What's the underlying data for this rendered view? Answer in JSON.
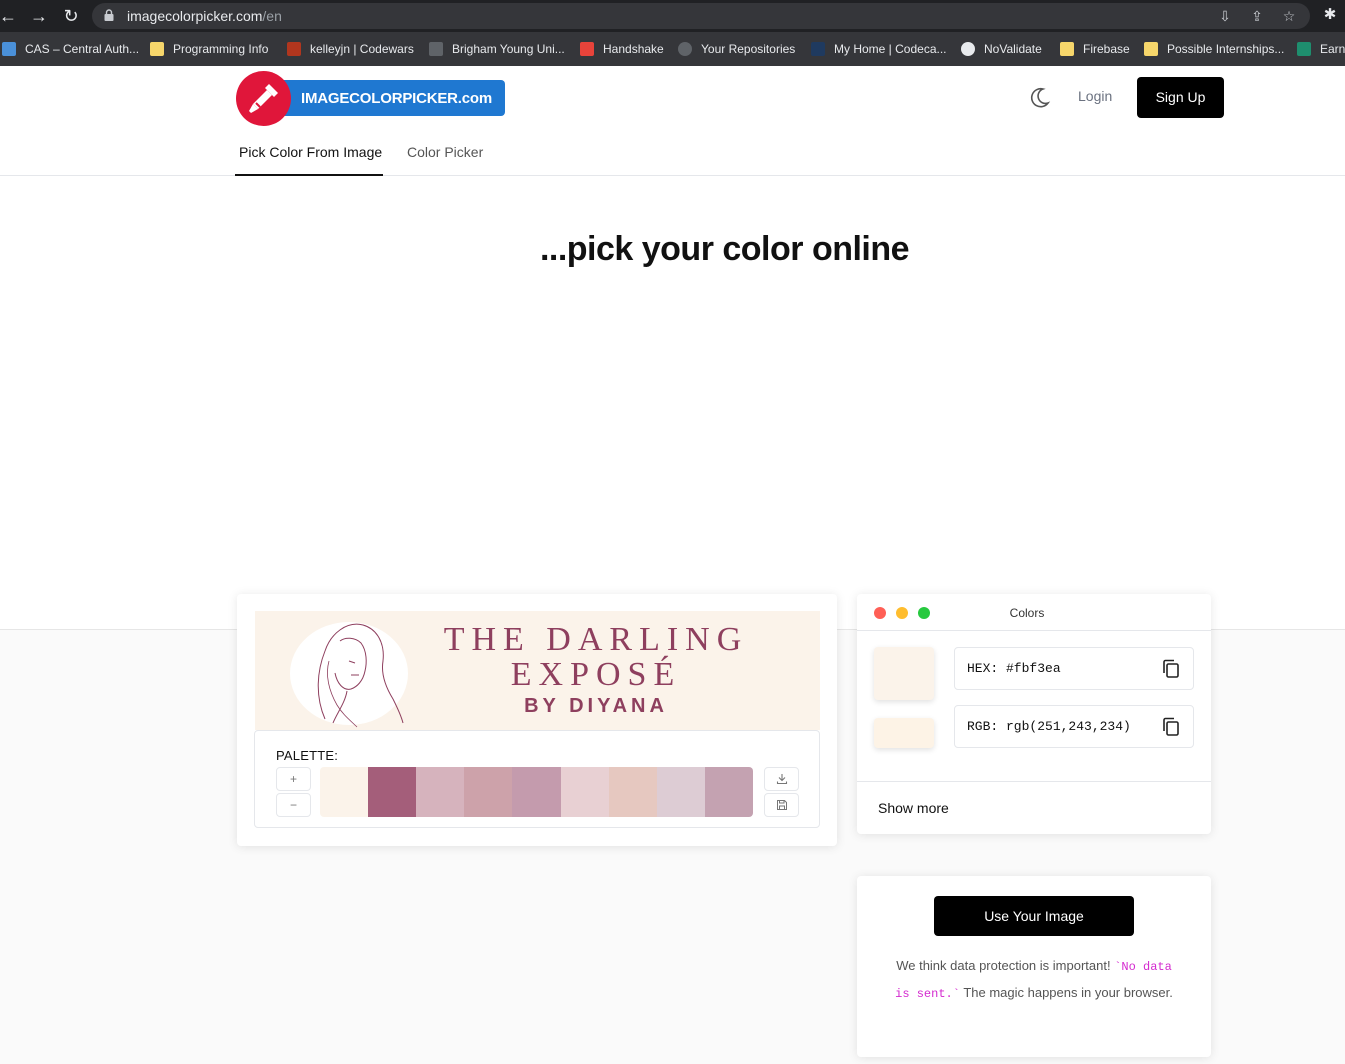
{
  "browser": {
    "url_host": "imagecolorpicker.com",
    "url_path": "/en",
    "bookmarks": [
      {
        "label": "CAS – Central Auth...",
        "color": "#4a90d9"
      },
      {
        "label": "Programming Info",
        "color": "#f6d66b"
      },
      {
        "label": "kelleyjn | Codewars",
        "color": "#b1361e"
      },
      {
        "label": "Brigham Young Uni...",
        "color": "#5f6368"
      },
      {
        "label": "Handshake",
        "color": "#e8433a"
      },
      {
        "label": "Your Repositories",
        "color": "#5f6368"
      },
      {
        "label": "My Home | Codeca...",
        "color": "#1f3a5f"
      },
      {
        "label": "NoValidate",
        "color": "#e8eaed"
      },
      {
        "label": "Firebase",
        "color": "#f6d66b"
      },
      {
        "label": "Possible Internships...",
        "color": "#f6d66b"
      },
      {
        "label": "Earn",
        "color": "#1e8e6e"
      }
    ]
  },
  "header": {
    "logo_text": "IMAGECOLORPICKER.com",
    "login": "Login",
    "signup": "Sign Up",
    "tabs": [
      "Pick Color From Image",
      "Color Picker"
    ],
    "active_tab": "Pick Color From Image"
  },
  "hero": {
    "title": "...pick your color online"
  },
  "image_card": {
    "banner_line1": "THE DARLING",
    "banner_line2": "EXPOSÉ",
    "banner_line3": "BY DIYANA",
    "palette_label": "PALETTE:",
    "add_label": "+",
    "remove_label": "−",
    "palette_colors": [
      "#fbf3ea",
      "#a45e7a",
      "#d6b3bd",
      "#cda2aa",
      "#c49bad",
      "#e8d0d3",
      "#e6c8c0",
      "#ddccd4",
      "#c4a2b1"
    ]
  },
  "colors_card": {
    "title": "Colors",
    "hex_text": "HEX: #fbf3ea",
    "rgb_text": "RGB: rgb(251,243,234)",
    "selected_color": "#fbf3ea",
    "secondary_color": "#fdf3e6",
    "show_more": "Show more"
  },
  "use_card": {
    "button": "Use Your Image",
    "privacy_before": "We think data protection is important! ",
    "privacy_code": "`No data is sent.`",
    "privacy_after": " The magic happens in your browser."
  }
}
